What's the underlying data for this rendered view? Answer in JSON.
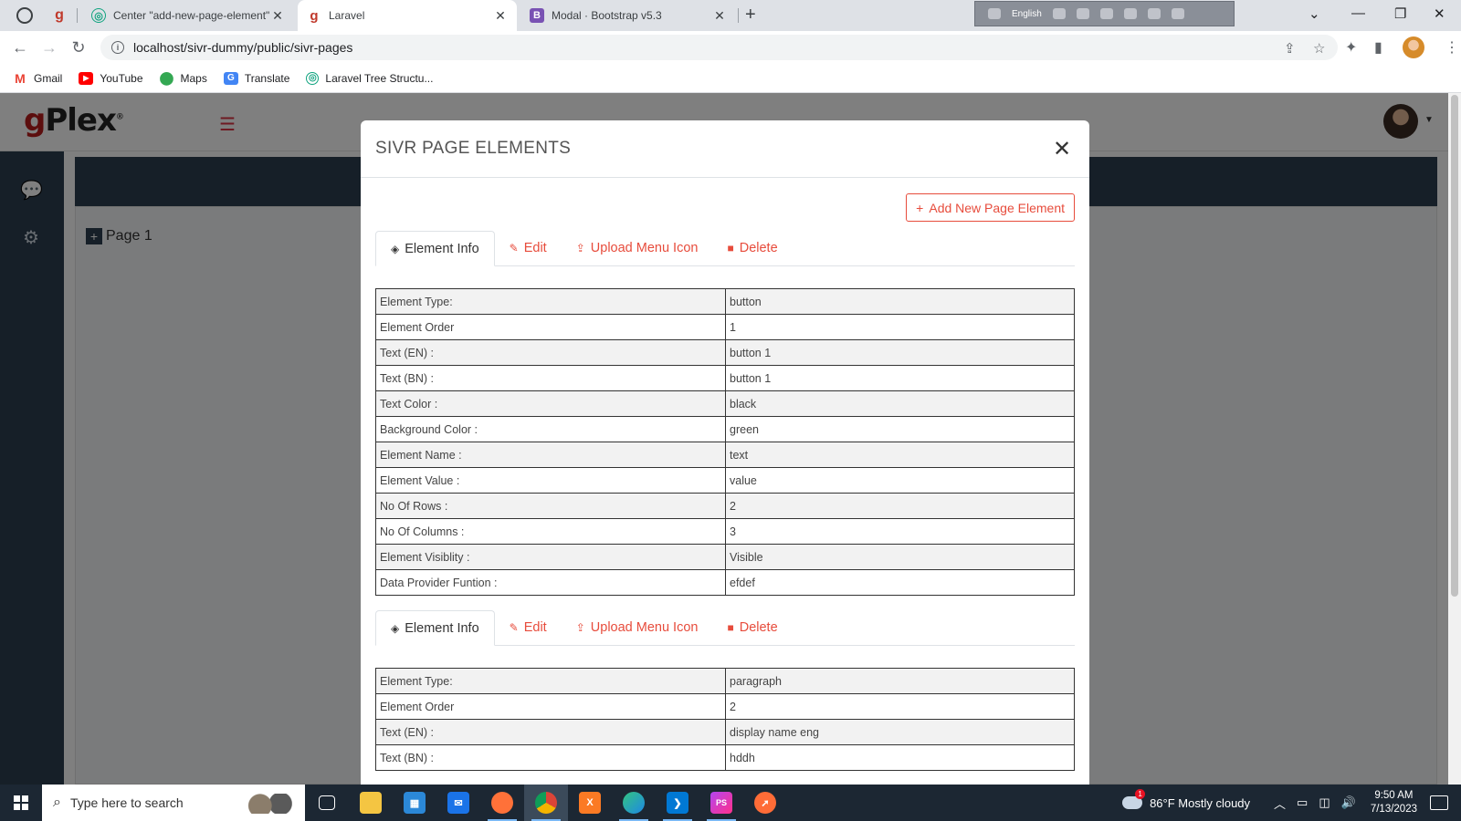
{
  "browser": {
    "tabs": [
      {
        "label": "Center \"add-new-page-element\" b",
        "active": false
      },
      {
        "label": "Laravel",
        "active": true
      },
      {
        "label": "Modal · Bootstrap v5.3",
        "active": false
      }
    ],
    "ime_label": "English",
    "url": "localhost/sivr-dummy/public/sivr-pages",
    "bookmarks": [
      {
        "label": "Gmail",
        "icon": "gmail-icon",
        "color": "#ea4335"
      },
      {
        "label": "YouTube",
        "icon": "youtube-icon",
        "color": "#ff0000"
      },
      {
        "label": "Maps",
        "icon": "maps-icon",
        "color": "#34a853"
      },
      {
        "label": "Translate",
        "icon": "translate-icon",
        "color": "#4285f4"
      },
      {
        "label": "Laravel Tree Structu...",
        "icon": "openai-icon",
        "color": "#10a37f"
      }
    ]
  },
  "app": {
    "logo_initial": "g",
    "logo_text": "Plex",
    "logo_mark": "®",
    "tree_item": "Page 1"
  },
  "modal": {
    "title": "SIVR PAGE ELEMENTS",
    "add_button": "Add New Page Element",
    "tabs": {
      "info": "Element Info",
      "edit": "Edit",
      "upload": "Upload Menu Icon",
      "delete": "Delete"
    },
    "elements": [
      {
        "rows": [
          {
            "label": "Element Type:",
            "value": "button"
          },
          {
            "label": "Element Order",
            "value": "1"
          },
          {
            "label": "Text (EN) :",
            "value": "button 1"
          },
          {
            "label": "Text (BN) :",
            "value": "button 1"
          },
          {
            "label": "Text Color :",
            "value": "black"
          },
          {
            "label": "Background Color :",
            "value": "green"
          },
          {
            "label": "Element Name :",
            "value": "text"
          },
          {
            "label": "Element Value :",
            "value": "value"
          },
          {
            "label": "No Of Rows :",
            "value": "2"
          },
          {
            "label": "No Of Columns :",
            "value": "3"
          },
          {
            "label": "Element Visiblity :",
            "value": "Visible"
          },
          {
            "label": "Data Provider Funtion :",
            "value": "efdef"
          }
        ]
      },
      {
        "rows": [
          {
            "label": "Element Type:",
            "value": "paragraph"
          },
          {
            "label": "Element Order",
            "value": "2"
          },
          {
            "label": "Text (EN) :",
            "value": "display name eng"
          },
          {
            "label": "Text (BN) :",
            "value": "hddh"
          }
        ]
      }
    ]
  },
  "taskbar": {
    "search_placeholder": "Type here to search",
    "weather": "86°F  Mostly cloudy",
    "time": "9:50 AM",
    "date": "7/13/2023"
  },
  "colors": {
    "accent": "#e74c3c",
    "sidebar": "#2c3e50"
  }
}
